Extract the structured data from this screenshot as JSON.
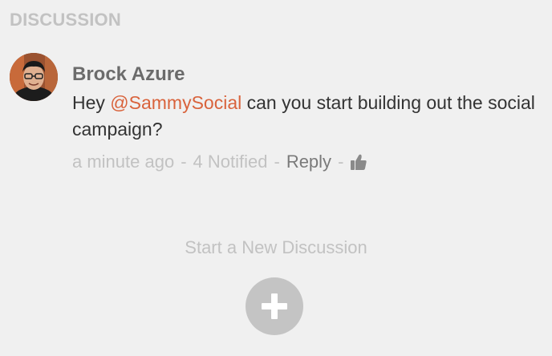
{
  "section": {
    "title": "DISCUSSION"
  },
  "comment": {
    "author": "Brock Azure",
    "text_prefix": "Hey ",
    "mention": "@SammySocial",
    "text_suffix": " can you start building out the social campaign?",
    "timestamp": "a minute ago",
    "separator": "-",
    "notified": "4 Notified",
    "reply_label": "Reply",
    "like_icon": "thumbs-up-icon",
    "avatar_icon": "avatar"
  },
  "new_discussion": {
    "label": "Start a New Discussion",
    "button_icon": "plus-icon"
  },
  "colors": {
    "background": "#f0f0f0",
    "muted_text": "#c2c2c2",
    "author_text": "#6b6b6b",
    "body_text": "#333333",
    "mention": "#d9633c",
    "add_button": "#c4c4c4"
  }
}
